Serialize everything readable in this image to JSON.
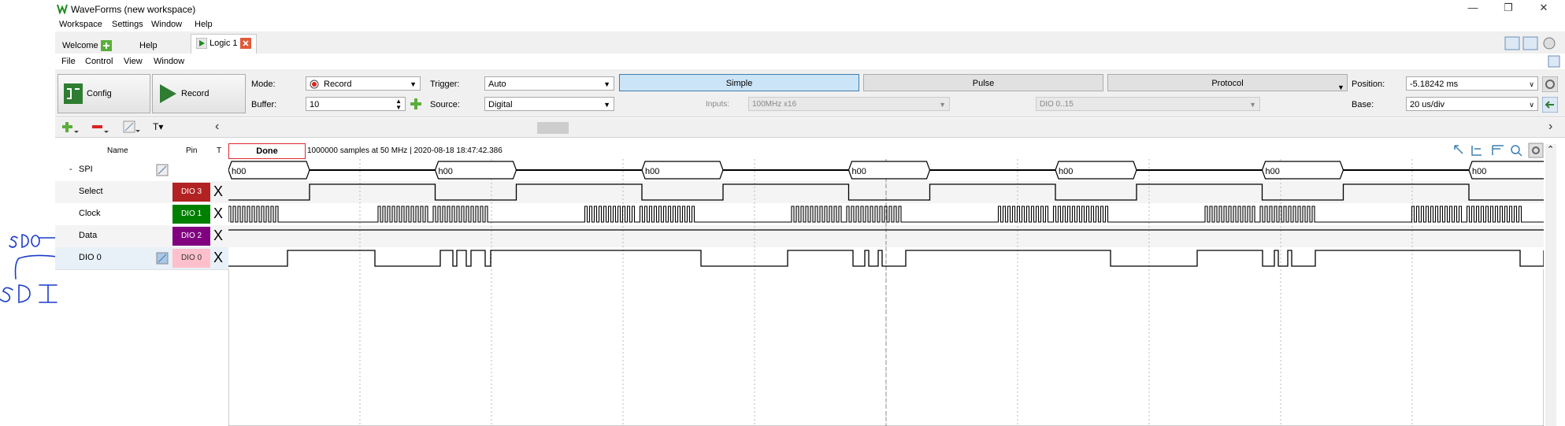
{
  "window": {
    "title": "WaveForms (new workspace)",
    "controls": [
      "—",
      "❐",
      "✕"
    ]
  },
  "menubar": {
    "items": [
      "Workspace",
      "Settings",
      "Window",
      "Help"
    ]
  },
  "tabs": [
    {
      "label": "Welcome"
    },
    {
      "label": "Help"
    },
    {
      "label": "Logic 1",
      "active": true
    }
  ],
  "submenu": {
    "items": [
      "File",
      "Control",
      "View",
      "Window"
    ]
  },
  "toolbar": {
    "config_label": "Config",
    "record_label": "Record",
    "mode_label": "Mode:",
    "mode_value": "Record",
    "buffer_label": "Buffer:",
    "buffer_value": "10",
    "trigger_label": "Trigger:",
    "trigger_value": "Auto",
    "source_label": "Source:",
    "source_value": "Digital",
    "trigger_tabs": [
      "Simple",
      "Pulse",
      "Protocol"
    ],
    "inputs_label": "Inputs:",
    "inputs_value": "100MHz x16",
    "dio_value": "DIO 0..15",
    "position_label": "Position:",
    "position_value": "-5.18242 ms",
    "base_label": "Base:",
    "base_value": "20 us/div"
  },
  "channel_header": {
    "name": "Name",
    "pin": "Pin",
    "t": "T"
  },
  "status": {
    "state": "Done",
    "info": "1000000 samples at 50 MHz | 2020-08-18 18:47:42.386"
  },
  "channels": [
    {
      "name": "SPI",
      "pin": "",
      "color": "",
      "type": "bus",
      "bus_value": "h00",
      "expand": "-"
    },
    {
      "name": "Select",
      "pin": "DIO 3",
      "color": "#b22222",
      "type": "signal"
    },
    {
      "name": "Clock",
      "pin": "DIO 1",
      "color": "#008000",
      "type": "signal"
    },
    {
      "name": "Data",
      "pin": "DIO 2",
      "color": "#800080",
      "type": "signal"
    },
    {
      "name": "DIO 0",
      "pin": "DIO 0",
      "color": "#ffc0cb",
      "type": "signal"
    }
  ],
  "annotations": [
    "SDO",
    "SDI"
  ],
  "colors": {
    "accent": "#3c7fb1",
    "status_border": "#e0262b"
  }
}
